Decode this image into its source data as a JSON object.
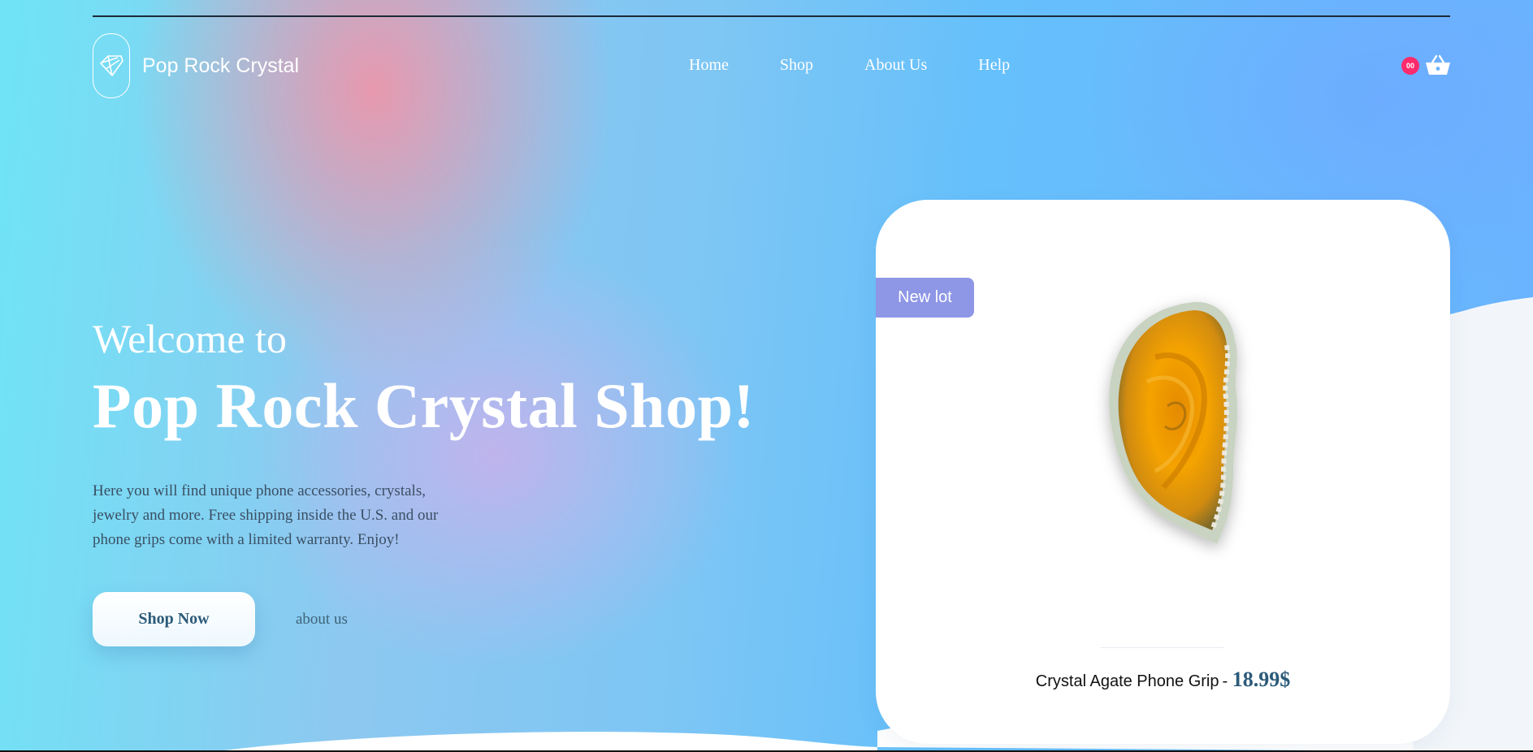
{
  "brand": {
    "name": "Pop Rock Crystal",
    "icon": "diamond-icon"
  },
  "nav": {
    "items": [
      {
        "label": "Home"
      },
      {
        "label": "Shop"
      },
      {
        "label": "About Us"
      },
      {
        "label": "Help"
      }
    ]
  },
  "cart": {
    "count": "00",
    "icon": "basket-icon",
    "badge_color": "#ff2b6c"
  },
  "hero": {
    "welcome": "Welcome to",
    "title": "Pop Rock Crystal Shop!",
    "description": "Here you will find unique phone accessories, crystals, jewelry and more. Free shipping inside the U.S. and our phone grips come with a limited warranty. Enjoy!",
    "primary_button": "Shop Now",
    "secondary_link": "about us"
  },
  "product": {
    "tag": "New lot",
    "name": "Crystal Agate Phone Grip",
    "separator": "-",
    "price": "18.99$",
    "image_icon": "agate-crystal-image"
  },
  "colors": {
    "accent": "#2b5a78",
    "tag": "#8e96e6",
    "white": "#ffffff"
  }
}
